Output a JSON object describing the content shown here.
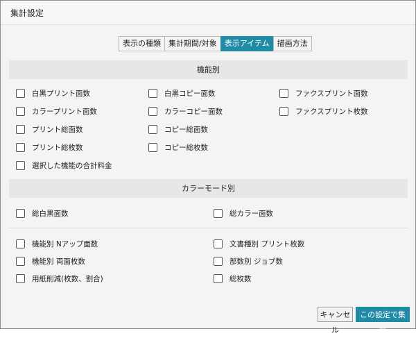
{
  "dialog": {
    "title": "集計設定",
    "accent_color": "#1f8ba4"
  },
  "tabs": [
    {
      "label": "表示の種類",
      "active": false
    },
    {
      "label": "集計期間/対象",
      "active": false
    },
    {
      "label": "表示アイテム",
      "active": true
    },
    {
      "label": "描画方法",
      "active": false
    }
  ],
  "sections": {
    "function": {
      "header": "機能別",
      "items": [
        "白黒プリント面数",
        "カラープリント面数",
        "プリント総面数",
        "プリント総枚数",
        "選択した機能の合計料金",
        "白黒コピー面数",
        "カラーコピー面数",
        "コピー総面数",
        "コピー総枚数",
        "ファクスプリント面数",
        "ファクスプリント枚数"
      ]
    },
    "color_mode": {
      "header": "カラーモード別",
      "items": [
        "総白黒面数",
        "総カラー面数"
      ]
    },
    "other": {
      "items": [
        "機能別 Nアップ面数",
        "機能別 両面枚数",
        "用紙削減(枚数、割合)",
        "文書種別 プリント枚数",
        "部数別 ジョブ数",
        "総枚数"
      ]
    }
  },
  "buttons": {
    "cancel": "キャンセル",
    "ok": "この設定で集計"
  }
}
